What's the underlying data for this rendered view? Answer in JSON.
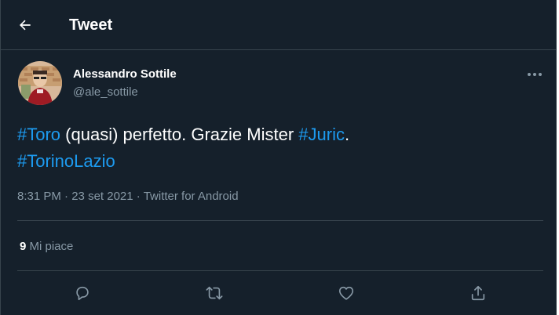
{
  "header": {
    "back_icon": "arrow-left-icon",
    "title": "Tweet"
  },
  "tweet": {
    "author": {
      "display_name": "Alessandro Sottile",
      "handle": "@ale_sottile"
    },
    "text": {
      "hashtag_1": "#Toro",
      "segment_1": " (quasi) perfetto. Grazie Mister ",
      "hashtag_2": "#Juric",
      "segment_2": ".",
      "hashtag_3": "#TorinoLazio"
    },
    "meta": {
      "time": "8:31 PM",
      "date": "23 set 2021",
      "source": "Twitter for Android",
      "separator": " · "
    },
    "stats": {
      "likes_count": "9",
      "likes_label": " Mi piace"
    }
  },
  "actions": [
    "reply-icon",
    "retweet-icon",
    "like-icon",
    "share-icon"
  ],
  "colors": {
    "background": "#15202b",
    "divider": "#38444d",
    "text_primary": "#ffffff",
    "text_secondary": "#8899a6",
    "accent": "#1d9bf0"
  }
}
